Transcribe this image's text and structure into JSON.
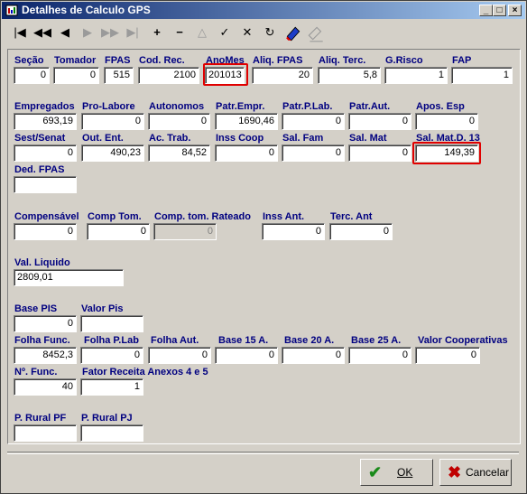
{
  "window": {
    "title": "Detalhes de Calculo GPS"
  },
  "titlebar_buttons": [
    "_",
    "□",
    "×"
  ],
  "toolbar": [
    "|◀",
    "◀◀",
    "◀",
    "▶",
    "▶▶",
    "▶|",
    "+",
    "−",
    "△",
    "✓",
    "✕",
    "↻"
  ],
  "fields": {
    "secao": {
      "label": "Seção",
      "value": "0"
    },
    "tomador": {
      "label": "Tomador",
      "value": "0"
    },
    "fpas": {
      "label": "FPAS",
      "value": "515"
    },
    "cod_rec": {
      "label": "Cod. Rec.",
      "value": "2100"
    },
    "anomes": {
      "label": "AnoMes",
      "value": "201013"
    },
    "aliq_fpas": {
      "label": "Aliq. FPAS",
      "value": "20"
    },
    "aliq_terc": {
      "label": "Aliq. Terc.",
      "value": "5,8"
    },
    "g_risco": {
      "label": "G.Risco",
      "value": "1"
    },
    "fap": {
      "label": "FAP",
      "value": "1"
    },
    "empregados": {
      "label": "Empregados",
      "value": "693,19"
    },
    "pro_labore": {
      "label": "Pro-Labore",
      "value": "0"
    },
    "autonomos": {
      "label": "Autonomos",
      "value": "0"
    },
    "patr_empr": {
      "label": "Patr.Empr.",
      "value": "1690,46"
    },
    "patr_p_lab": {
      "label": "Patr.P.Lab.",
      "value": "0"
    },
    "patr_aut": {
      "label": "Patr.Aut.",
      "value": "0"
    },
    "apos_esp": {
      "label": "Apos. Esp",
      "value": "0"
    },
    "sest_senat": {
      "label": "Sest/Senat",
      "value": "0"
    },
    "out_ent": {
      "label": "Out. Ent.",
      "value": "490,23"
    },
    "ac_trab": {
      "label": "Ac. Trab.",
      "value": "84,52"
    },
    "inss_coop": {
      "label": "Inss Coop",
      "value": "0"
    },
    "sal_fam": {
      "label": "Sal. Fam",
      "value": "0"
    },
    "sal_mat": {
      "label": "Sal. Mat",
      "value": "0"
    },
    "sal_mat_d13": {
      "label": "Sal. Mat.D. 13",
      "value": "149,39"
    },
    "ded_fpas": {
      "label": "Ded. FPAS",
      "value": ""
    },
    "compensavel": {
      "label": "Compensável",
      "value": "0"
    },
    "comp_tom": {
      "label": "Comp Tom.",
      "value": "0"
    },
    "comp_tom_rateado": {
      "label": "Comp. tom. Rateado",
      "value": "0"
    },
    "inss_ant": {
      "label": "Inss Ant.",
      "value": "0"
    },
    "terc_ant": {
      "label": "Terc. Ant",
      "value": "0"
    },
    "val_liquido": {
      "label": "Val. Liquido",
      "value": "2809,01"
    },
    "base_pis": {
      "label": "Base PIS",
      "value": "0"
    },
    "valor_pis": {
      "label": "Valor Pis",
      "value": ""
    },
    "folha_func": {
      "label": "Folha Func.",
      "value": "8452,3"
    },
    "folha_p_lab": {
      "label": "Folha P.Lab",
      "value": "0"
    },
    "folha_aut": {
      "label": "Folha Aut.",
      "value": "0"
    },
    "base_15a": {
      "label": "Base 15 A.",
      "value": "0"
    },
    "base_20a": {
      "label": "Base 20 A.",
      "value": "0"
    },
    "base_25a": {
      "label": "Base 25 A.",
      "value": "0"
    },
    "valor_cooperativas": {
      "label": "Valor Cooperativas",
      "value": "0"
    },
    "n_func": {
      "label": "Nº. Func.",
      "value": "40"
    },
    "fator_receita": {
      "label": "Fator Receita Anexos 4 e 5",
      "value": "1"
    },
    "p_rural_pf": {
      "label": "P. Rural  PF",
      "value": ""
    },
    "p_rural_pj": {
      "label": "P. Rural  PJ",
      "value": ""
    }
  },
  "buttons": {
    "ok": "OK",
    "cancel": "Cancelar"
  }
}
